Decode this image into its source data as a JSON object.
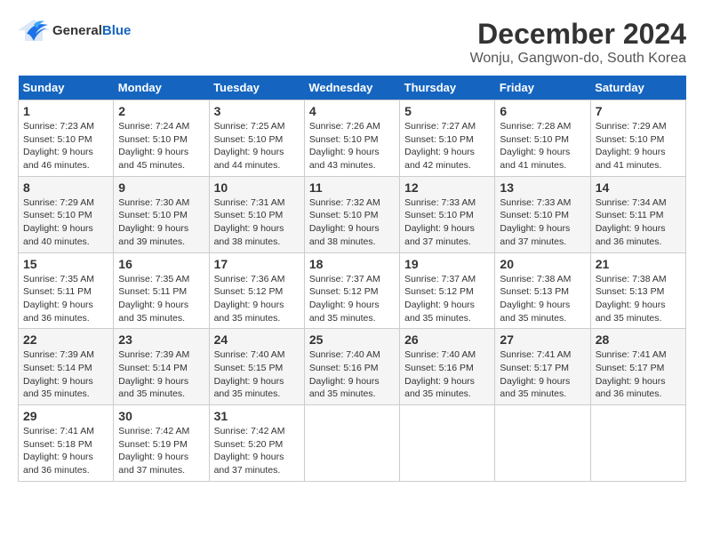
{
  "header": {
    "logo_general": "General",
    "logo_blue": "Blue",
    "title": "December 2024",
    "subtitle": "Wonju, Gangwon-do, South Korea"
  },
  "days_of_week": [
    "Sunday",
    "Monday",
    "Tuesday",
    "Wednesday",
    "Thursday",
    "Friday",
    "Saturday"
  ],
  "weeks": [
    [
      {
        "day": "1",
        "sunrise": "Sunrise: 7:23 AM",
        "sunset": "Sunset: 5:10 PM",
        "daylight": "Daylight: 9 hours and 46 minutes."
      },
      {
        "day": "2",
        "sunrise": "Sunrise: 7:24 AM",
        "sunset": "Sunset: 5:10 PM",
        "daylight": "Daylight: 9 hours and 45 minutes."
      },
      {
        "day": "3",
        "sunrise": "Sunrise: 7:25 AM",
        "sunset": "Sunset: 5:10 PM",
        "daylight": "Daylight: 9 hours and 44 minutes."
      },
      {
        "day": "4",
        "sunrise": "Sunrise: 7:26 AM",
        "sunset": "Sunset: 5:10 PM",
        "daylight": "Daylight: 9 hours and 43 minutes."
      },
      {
        "day": "5",
        "sunrise": "Sunrise: 7:27 AM",
        "sunset": "Sunset: 5:10 PM",
        "daylight": "Daylight: 9 hours and 42 minutes."
      },
      {
        "day": "6",
        "sunrise": "Sunrise: 7:28 AM",
        "sunset": "Sunset: 5:10 PM",
        "daylight": "Daylight: 9 hours and 41 minutes."
      },
      {
        "day": "7",
        "sunrise": "Sunrise: 7:29 AM",
        "sunset": "Sunset: 5:10 PM",
        "daylight": "Daylight: 9 hours and 41 minutes."
      }
    ],
    [
      {
        "day": "8",
        "sunrise": "Sunrise: 7:29 AM",
        "sunset": "Sunset: 5:10 PM",
        "daylight": "Daylight: 9 hours and 40 minutes."
      },
      {
        "day": "9",
        "sunrise": "Sunrise: 7:30 AM",
        "sunset": "Sunset: 5:10 PM",
        "daylight": "Daylight: 9 hours and 39 minutes."
      },
      {
        "day": "10",
        "sunrise": "Sunrise: 7:31 AM",
        "sunset": "Sunset: 5:10 PM",
        "daylight": "Daylight: 9 hours and 38 minutes."
      },
      {
        "day": "11",
        "sunrise": "Sunrise: 7:32 AM",
        "sunset": "Sunset: 5:10 PM",
        "daylight": "Daylight: 9 hours and 38 minutes."
      },
      {
        "day": "12",
        "sunrise": "Sunrise: 7:33 AM",
        "sunset": "Sunset: 5:10 PM",
        "daylight": "Daylight: 9 hours and 37 minutes."
      },
      {
        "day": "13",
        "sunrise": "Sunrise: 7:33 AM",
        "sunset": "Sunset: 5:10 PM",
        "daylight": "Daylight: 9 hours and 37 minutes."
      },
      {
        "day": "14",
        "sunrise": "Sunrise: 7:34 AM",
        "sunset": "Sunset: 5:11 PM",
        "daylight": "Daylight: 9 hours and 36 minutes."
      }
    ],
    [
      {
        "day": "15",
        "sunrise": "Sunrise: 7:35 AM",
        "sunset": "Sunset: 5:11 PM",
        "daylight": "Daylight: 9 hours and 36 minutes."
      },
      {
        "day": "16",
        "sunrise": "Sunrise: 7:35 AM",
        "sunset": "Sunset: 5:11 PM",
        "daylight": "Daylight: 9 hours and 35 minutes."
      },
      {
        "day": "17",
        "sunrise": "Sunrise: 7:36 AM",
        "sunset": "Sunset: 5:12 PM",
        "daylight": "Daylight: 9 hours and 35 minutes."
      },
      {
        "day": "18",
        "sunrise": "Sunrise: 7:37 AM",
        "sunset": "Sunset: 5:12 PM",
        "daylight": "Daylight: 9 hours and 35 minutes."
      },
      {
        "day": "19",
        "sunrise": "Sunrise: 7:37 AM",
        "sunset": "Sunset: 5:12 PM",
        "daylight": "Daylight: 9 hours and 35 minutes."
      },
      {
        "day": "20",
        "sunrise": "Sunrise: 7:38 AM",
        "sunset": "Sunset: 5:13 PM",
        "daylight": "Daylight: 9 hours and 35 minutes."
      },
      {
        "day": "21",
        "sunrise": "Sunrise: 7:38 AM",
        "sunset": "Sunset: 5:13 PM",
        "daylight": "Daylight: 9 hours and 35 minutes."
      }
    ],
    [
      {
        "day": "22",
        "sunrise": "Sunrise: 7:39 AM",
        "sunset": "Sunset: 5:14 PM",
        "daylight": "Daylight: 9 hours and 35 minutes."
      },
      {
        "day": "23",
        "sunrise": "Sunrise: 7:39 AM",
        "sunset": "Sunset: 5:14 PM",
        "daylight": "Daylight: 9 hours and 35 minutes."
      },
      {
        "day": "24",
        "sunrise": "Sunrise: 7:40 AM",
        "sunset": "Sunset: 5:15 PM",
        "daylight": "Daylight: 9 hours and 35 minutes."
      },
      {
        "day": "25",
        "sunrise": "Sunrise: 7:40 AM",
        "sunset": "Sunset: 5:16 PM",
        "daylight": "Daylight: 9 hours and 35 minutes."
      },
      {
        "day": "26",
        "sunrise": "Sunrise: 7:40 AM",
        "sunset": "Sunset: 5:16 PM",
        "daylight": "Daylight: 9 hours and 35 minutes."
      },
      {
        "day": "27",
        "sunrise": "Sunrise: 7:41 AM",
        "sunset": "Sunset: 5:17 PM",
        "daylight": "Daylight: 9 hours and 35 minutes."
      },
      {
        "day": "28",
        "sunrise": "Sunrise: 7:41 AM",
        "sunset": "Sunset: 5:17 PM",
        "daylight": "Daylight: 9 hours and 36 minutes."
      }
    ],
    [
      {
        "day": "29",
        "sunrise": "Sunrise: 7:41 AM",
        "sunset": "Sunset: 5:18 PM",
        "daylight": "Daylight: 9 hours and 36 minutes."
      },
      {
        "day": "30",
        "sunrise": "Sunrise: 7:42 AM",
        "sunset": "Sunset: 5:19 PM",
        "daylight": "Daylight: 9 hours and 37 minutes."
      },
      {
        "day": "31",
        "sunrise": "Sunrise: 7:42 AM",
        "sunset": "Sunset: 5:20 PM",
        "daylight": "Daylight: 9 hours and 37 minutes."
      },
      null,
      null,
      null,
      null
    ]
  ]
}
